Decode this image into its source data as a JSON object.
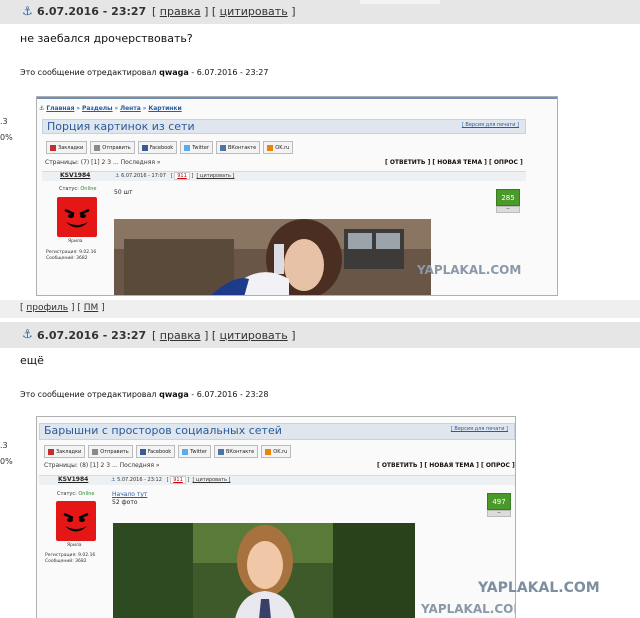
{
  "post1": {
    "date": "6.07.2016 - 23:27",
    "action_edit": "правка",
    "action_quote": "цитировать",
    "message": "не заебался дрочерствовать?",
    "edited_prefix": "Это сообщение отредактировал",
    "edited_user": "qwaga",
    "edited_suffix": "- 6.07.2016 - 23:27",
    "side_fragment_1": ".3",
    "side_fragment_2": "0%",
    "embed": {
      "breadcrumb": [
        "Главная",
        "Разделы",
        "Лента",
        "Картинки"
      ],
      "title": "Порция картинок из сети",
      "version_link": "[ Версия для печати ]",
      "share_buttons": [
        "Закладки",
        "Отправить",
        "Facebook",
        "Twitter",
        "ВКонтакте",
        "OK.ru"
      ],
      "pages_text": "Страницы: (7) [1] 2 3 ... Последняя »",
      "controls": "[ ОТВЕТИТЬ ] [ НОВАЯ ТЕМА ] [ ОПРОС ]",
      "username": "KSV1984",
      "post_date": "6.07.2016 - 17:07",
      "post_number": "911",
      "quote_link": "[ цитировать ]",
      "status_label": "Статус:",
      "status_value": "Online",
      "avatar_caption": "Ярила",
      "reg": "Регистрация: 9.02.16",
      "posts": "Сообщений: 3682",
      "body": "50 шт",
      "score": "285",
      "score_minus": "−",
      "watermark": "YAPLAKAL.COM"
    }
  },
  "footer": {
    "profile": "профиль",
    "pm": "ПМ"
  },
  "post2": {
    "date": "6.07.2016 - 23:27",
    "action_edit": "правка",
    "action_quote": "цитировать",
    "message": "ещё",
    "edited_prefix": "Это сообщение отредактировал",
    "edited_user": "qwaga",
    "edited_suffix": "- 6.07.2016 - 23:28",
    "side_fragment_1": ".3",
    "side_fragment_2": "0%",
    "embed": {
      "title": "Барышни с просторов социальных сетей",
      "version_link": "[ Версия для печати ]",
      "share_buttons": [
        "Закладки",
        "Отправить",
        "Facebook",
        "Twitter",
        "ВКонтакте",
        "OK.ru"
      ],
      "pages_text": "Страницы: (8) [1] 2 3 ... Последняя »",
      "controls": "[ ОТВЕТИТЬ ] [ НОВАЯ ТЕМА ] [ ОПРОС ]",
      "username": "KSV1984",
      "post_date": "5.07.2016 - 23:12",
      "post_number": "911",
      "quote_link": "[ цитировать ]",
      "status_label": "Статус:",
      "status_value": "Online",
      "avatar_caption": "Ярила",
      "reg": "Регистрация: 9.02.16",
      "posts": "Сообщений: 3682",
      "body_link": "Начало тут",
      "body": "52 фото",
      "score": "497",
      "score_minus": "−",
      "watermark_1": "YAPLAKAL.COM",
      "watermark_2": "YAPLAKAL.COM"
    }
  }
}
